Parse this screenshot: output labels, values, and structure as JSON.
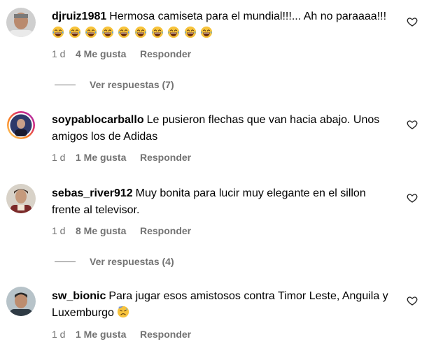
{
  "comments": [
    {
      "username": "djruiz1981",
      "text": "Hermosa camiseta para el mundial!!!... Ah no paraaaa!!!",
      "emoji_count": 10,
      "emoji_icon": "laughing-tears-emoji",
      "time": "1 d",
      "likes": "4 Me gusta",
      "reply": "Responder",
      "view_replies": "Ver respuestas (7)"
    },
    {
      "username": "soypablocarballo",
      "text": "Le pusieron flechas que van hacia abajo. Unos amigos los de Adidas",
      "time": "1 d",
      "likes": "1 Me gusta",
      "reply": "Responder"
    },
    {
      "username": "sebas_river912",
      "text": "Muy bonita para lucir muy elegante en el sillon frente al televisor.",
      "time": "1 d",
      "likes": "8 Me gusta",
      "reply": "Responder",
      "view_replies": "Ver respuestas (4)"
    },
    {
      "username": "sw_bionic",
      "text": "Para jugar esos amistosos contra Timor Leste, Anguila y Luxemburgo",
      "emoji_icon": "disappointed-sweat-emoji",
      "time": "1 d",
      "likes": "1 Me gusta",
      "reply": "Responder"
    }
  ],
  "colors": {
    "meta": "#737373",
    "text": "#000000",
    "emoji_face": "#F7C33B",
    "story_ring": "#D62976"
  }
}
